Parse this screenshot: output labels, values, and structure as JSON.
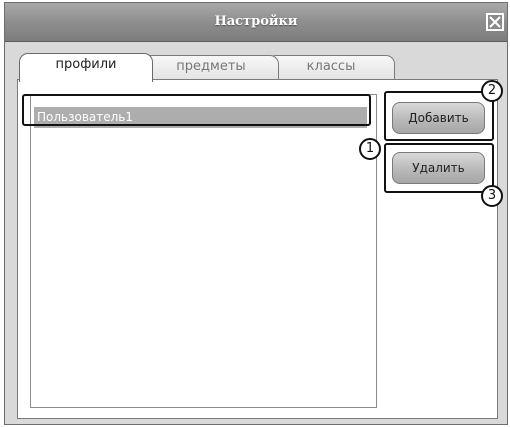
{
  "window": {
    "title": "Настройки"
  },
  "tabs": [
    {
      "label": "профили",
      "active": true
    },
    {
      "label": "предметы",
      "active": false
    },
    {
      "label": "классы",
      "active": false
    }
  ],
  "profiles": {
    "items": [
      "Пользователь1"
    ],
    "selected_index": 0
  },
  "buttons": {
    "add_label": "Добавить",
    "delete_label": "Удалить"
  },
  "callouts": [
    "1",
    "2",
    "3"
  ]
}
